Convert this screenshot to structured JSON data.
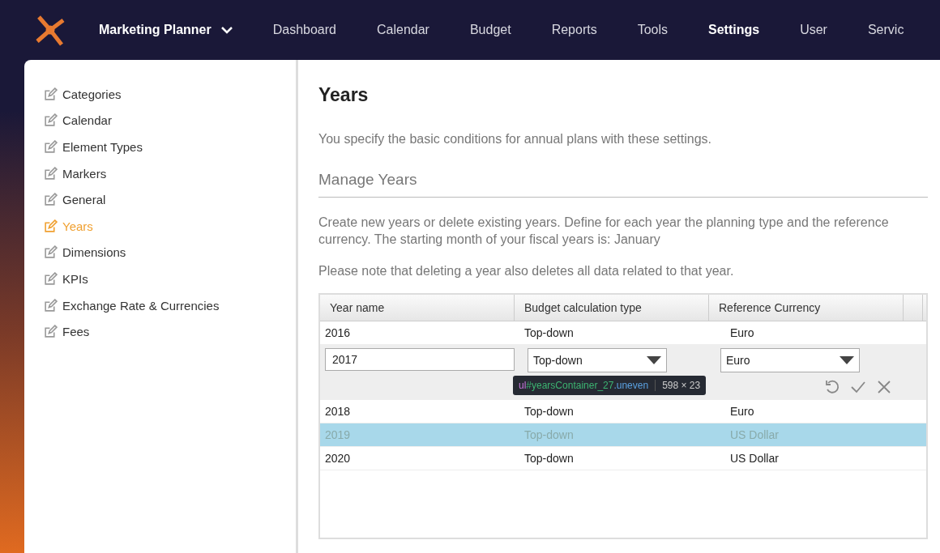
{
  "nav": {
    "product": "Marketing Planner",
    "items": [
      {
        "label": "Dashboard",
        "selected": false
      },
      {
        "label": "Calendar",
        "selected": false
      },
      {
        "label": "Budget",
        "selected": false
      },
      {
        "label": "Reports",
        "selected": false
      },
      {
        "label": "Tools",
        "selected": false
      },
      {
        "label": "Settings",
        "selected": true
      },
      {
        "label": "User",
        "selected": false
      },
      {
        "label": "Servic",
        "selected": false
      }
    ]
  },
  "sidebar": {
    "items": [
      {
        "label": "Categories",
        "selected": false
      },
      {
        "label": "Calendar",
        "selected": false
      },
      {
        "label": "Element Types",
        "selected": false
      },
      {
        "label": "Markers",
        "selected": false
      },
      {
        "label": "General",
        "selected": false
      },
      {
        "label": "Years",
        "selected": true
      },
      {
        "label": "Dimensions",
        "selected": false
      },
      {
        "label": "KPIs",
        "selected": false
      },
      {
        "label": "Exchange Rate & Currencies",
        "selected": false
      },
      {
        "label": "Fees",
        "selected": false
      }
    ]
  },
  "page": {
    "title": "Years",
    "intro": "You specify the basic conditions for annual plans with these settings.",
    "section_title": "Manage Years",
    "description": "Create new years or delete existing years. Define for each year the planning type and the reference currency. The starting month of your fiscal years is: January",
    "note": "Please note that deleting a year also deletes all data related to that year."
  },
  "table": {
    "columns": [
      "Year name",
      "Budget calculation type",
      "Reference Currency"
    ],
    "rows": [
      {
        "kind": "plain",
        "selected": false,
        "cells": [
          "2016",
          "Top-down",
          "Euro"
        ]
      },
      {
        "kind": "edit",
        "selected": false,
        "cells": [
          "2017",
          "Top-down",
          "Euro"
        ]
      },
      {
        "kind": "plain",
        "selected": false,
        "cells": [
          "2018",
          "Top-down",
          "Euro"
        ]
      },
      {
        "kind": "plain",
        "selected": true,
        "cells": [
          "2019",
          "Top-down",
          "US Dollar"
        ]
      },
      {
        "kind": "plain",
        "selected": false,
        "cells": [
          "2020",
          "Top-down",
          "US Dollar"
        ]
      }
    ]
  },
  "inspector_tooltip": {
    "selector_tag": "ul",
    "selector_id": "#yearsContainer_27",
    "selector_class": ".uneven",
    "size": "598 × 23"
  }
}
